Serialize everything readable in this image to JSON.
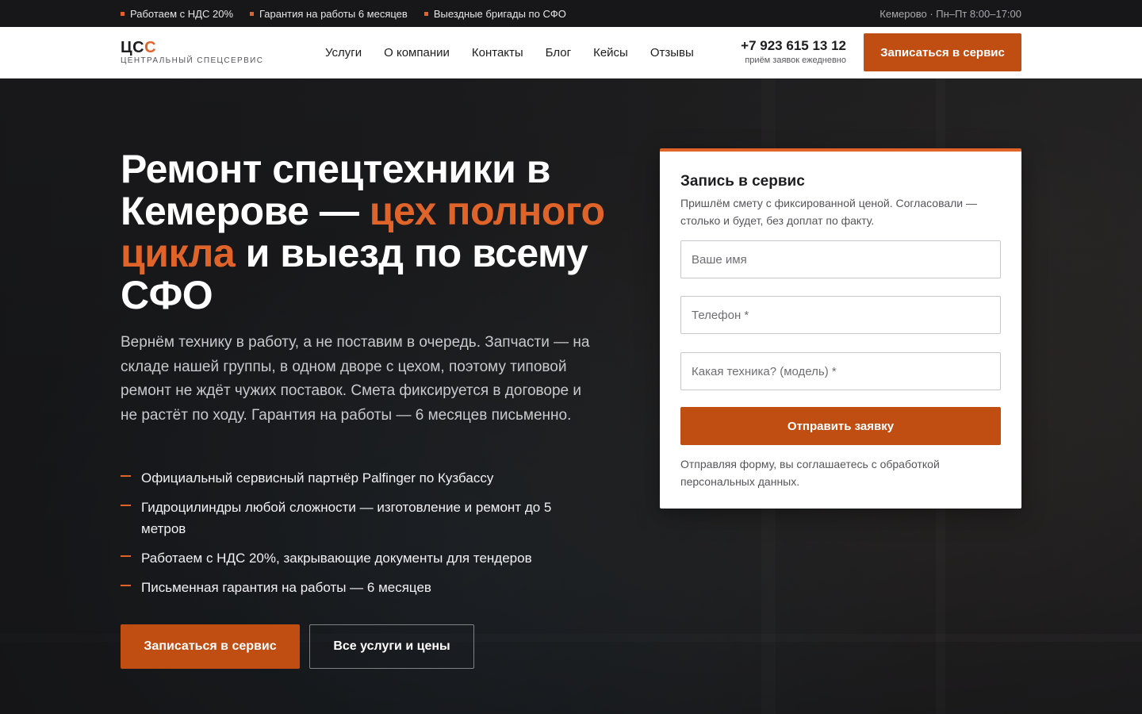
{
  "topbar": {
    "items": [
      "Работаем с НДС 20%",
      "Гарантия на работы 6 месяцев",
      "Выездные бригады по СФО"
    ],
    "right_text": "Кемерово · Пн–Пт 8:00–17:00"
  },
  "header": {
    "logo": {
      "mark_main": "ЦС",
      "mark_accent": "С",
      "subtitle": "ЦЕНТРАЛЬНЫЙ СПЕЦСЕРВИС"
    },
    "nav": [
      "Услуги",
      "О компании",
      "Контакты",
      "Блог",
      "Кейсы",
      "Отзывы"
    ],
    "phone": "+7 923 615 13 12",
    "phone_note": "приём заявок ежедневно",
    "cta_label": "Записаться в сервис"
  },
  "hero": {
    "title_part1": "Ремонт спецтехники в Кемерове — ",
    "title_accent": "цех полного цикла",
    "title_part2": " и выезд по всему СФО",
    "lead": "Вернём технику в работу, а не поставим в очередь. Запчасти — на складе нашей группы, в одном дворе с цехом, поэтому типовой ремонт не ждёт чужих поставок. Смета фиксируется в договоре и не растёт по ходу. Гарантия на работы — 6 месяцев письменно.",
    "features": [
      "Официальный сервисный партнёр Palfinger по Кузбассу",
      "Гидроцилиндры любой сложности — изготовление и ремонт до 5 метров",
      "Работаем с НДС 20%, закрывающие документы для тендеров",
      "Письменная гарантия на работы — 6 месяцев"
    ],
    "primary_button": "Записаться в сервис",
    "secondary_button": "Все услуги и цены"
  },
  "form": {
    "title": "Запись в сервис",
    "subtitle": "Пришлём смету с фиксированной ценой. Согласовали — столько и будет, без доплат по факту.",
    "name_placeholder": "Ваше имя",
    "phone_placeholder": "Телефон *",
    "machine_placeholder": "Какая техника? (модель) *",
    "submit_label": "Отправить заявку",
    "note": "Отправляя форму, вы соглашаетесь с обработкой персональных данных."
  },
  "colors": {
    "accent": "#e0642a",
    "button": "#c04d12",
    "topbar_bg": "#17171a"
  }
}
